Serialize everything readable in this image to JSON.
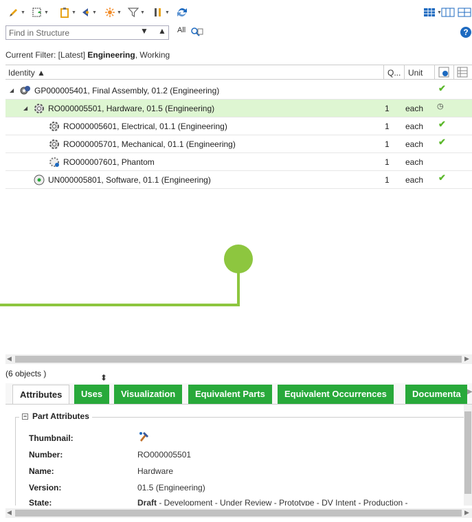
{
  "toolbar": {
    "icons": [
      "pencil-icon",
      "insert-icon",
      "clipboard-icon",
      "navigate-icon",
      "starburst-icon",
      "filter-icon",
      "tools-icon",
      "sync-icon",
      "layout-icon",
      "columns-icon"
    ],
    "colors": {
      "accent_green": "#28a93a",
      "selection_green": "#def6d2",
      "check_green": "#5cb82c"
    }
  },
  "search": {
    "placeholder": "Find in Structure",
    "all_label": "All"
  },
  "filter": {
    "prefix": "Current Filter: [Latest] ",
    "bold": "Engineering",
    "suffix": ", Working"
  },
  "table": {
    "headers": {
      "identity": "Identity ▲",
      "quantity": "Q...",
      "unit": "Unit"
    },
    "rows": [
      {
        "label": "GP000005401, Final Assembly, 01.2 (Engineering)",
        "qty": "",
        "unit": "",
        "status": "check"
      },
      {
        "label": "RO000005501, Hardware, 01.5 (Engineering)",
        "qty": "1",
        "unit": "each",
        "status": "clock"
      },
      {
        "label": "RO000005601, Electrical, 01.1 (Engineering)",
        "qty": "1",
        "unit": "each",
        "status": "check"
      },
      {
        "label": "RO000005701, Mechanical, 01.1 (Engineering)",
        "qty": "1",
        "unit": "each",
        "status": "check"
      },
      {
        "label": "RO000007601, Phantom",
        "qty": "1",
        "unit": "each",
        "status": ""
      },
      {
        "label": "UN000005801, Software, 01.1 (Engineering)",
        "qty": "1",
        "unit": "each",
        "status": "check"
      }
    ]
  },
  "count": "(6 objects )",
  "tabs": [
    "Attributes",
    "Uses",
    "Visualization",
    "Equivalent Parts",
    "Equivalent Occurrences",
    "Documenta"
  ],
  "attributes": {
    "section_title": "Part Attributes",
    "thumbnail_label": "Thumbnail:",
    "number_label": "Number:",
    "number_value": "RO000005501",
    "name_label": "Name:",
    "name_value": "Hardware",
    "version_label": "Version:",
    "version_value": "01.5 (Engineering)",
    "state_label": "State:",
    "state_bold": "Draft",
    "state_rest": " - Development - Under Review - Prototype - DV Intent - Production -"
  }
}
